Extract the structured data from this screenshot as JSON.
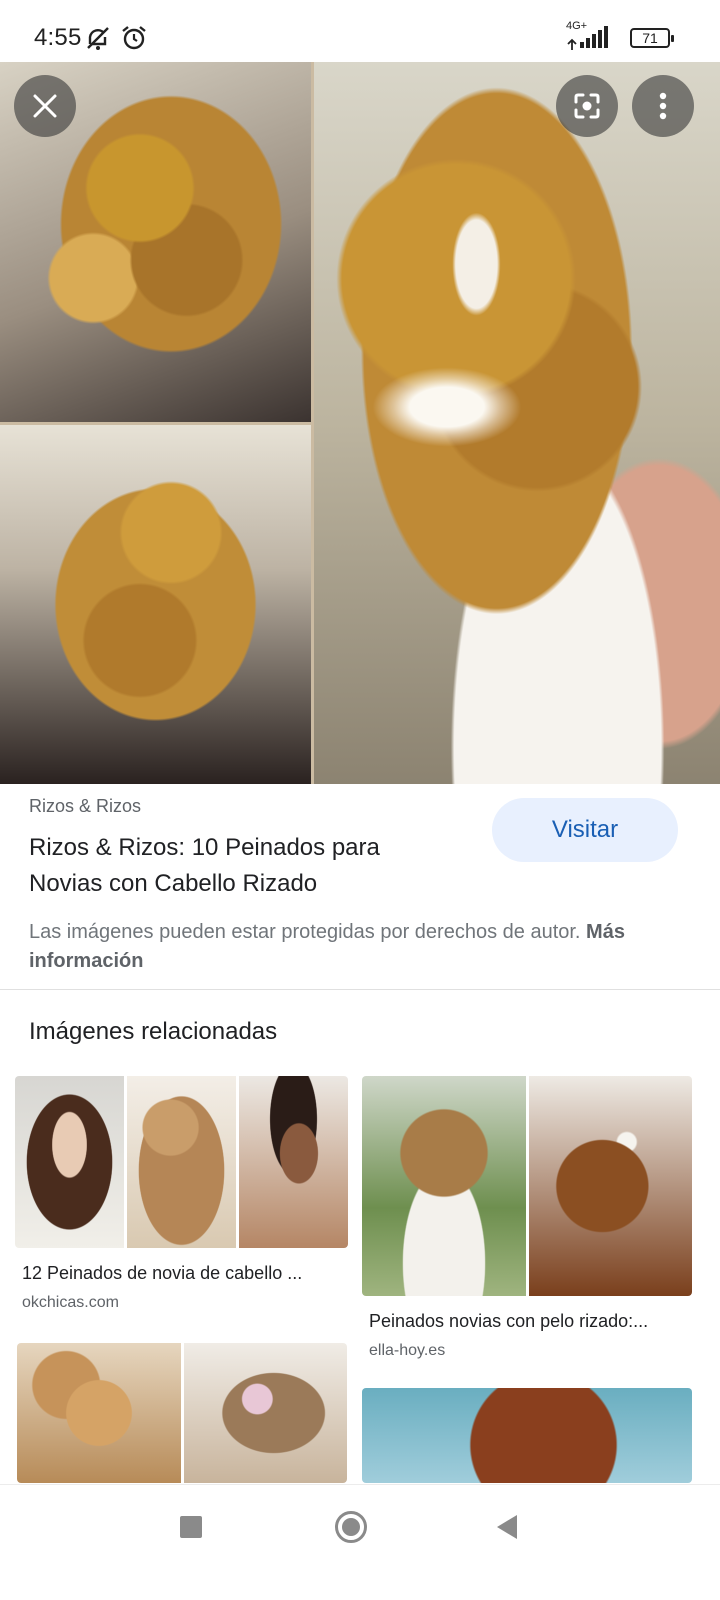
{
  "status_bar": {
    "time": "4:55",
    "network": "4G+",
    "battery": "71",
    "icons": [
      "mute-icon",
      "alarm-icon",
      "signal-icon",
      "battery-icon"
    ]
  },
  "hero": {
    "buttons": {
      "close": "close-icon",
      "lens": "lens-icon",
      "more": "more-vert-icon"
    }
  },
  "result": {
    "source": "Rizos & Rizos",
    "title": "Rizos & Rizos: 10 Peinados para Novias con Cabello Rizado",
    "visit_label": "Visitar",
    "copyright_text": "Las imágenes pueden estar protegidas por derechos de autor.",
    "more_info": "Más información"
  },
  "related": {
    "heading": "Imágenes relacionadas",
    "items": [
      {
        "title": "12 Peinados de novia de cabello ...",
        "domain": "okchicas.com"
      },
      {
        "title": "Peinados novias con pelo rizado:...",
        "domain": "ella-hoy.es"
      },
      {
        "title": "",
        "domain": ""
      },
      {
        "title": "",
        "domain": ""
      }
    ]
  },
  "colors": {
    "visit_bg": "#e8f0fe",
    "visit_text": "#1a5fb4",
    "secondary_text": "#5f6368"
  },
  "nav": {
    "icons": [
      "recent-apps-icon",
      "home-icon",
      "back-icon"
    ]
  }
}
